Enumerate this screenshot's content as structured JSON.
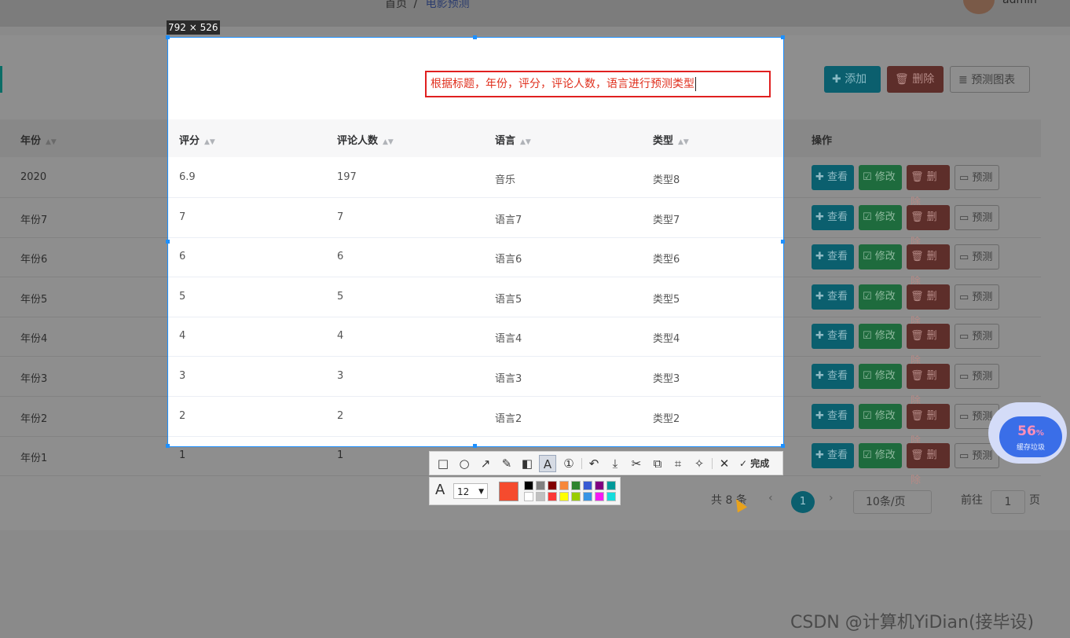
{
  "app": {
    "breadcrumb_home": "首页",
    "breadcrumb_sep": "/",
    "breadcrumb_current": "电影预测",
    "user": "admin"
  },
  "toolbar_buttons": {
    "add": "添加",
    "delete": "删除",
    "chart": "预测图表"
  },
  "table": {
    "headers": {
      "year": "年份",
      "score": "评分",
      "reviewers": "评论人数",
      "language": "语言",
      "type": "类型",
      "actions": "操作"
    },
    "rows": [
      {
        "year": "2020",
        "score": "6.9",
        "reviewers": "197",
        "language": "音乐",
        "type": "类型8"
      },
      {
        "year": "年份7",
        "score": "7",
        "reviewers": "7",
        "language": "语言7",
        "type": "类型7"
      },
      {
        "year": "年份6",
        "score": "6",
        "reviewers": "6",
        "language": "语言6",
        "type": "类型6"
      },
      {
        "year": "年份5",
        "score": "5",
        "reviewers": "5",
        "language": "语言5",
        "type": "类型5"
      },
      {
        "year": "年份4",
        "score": "4",
        "reviewers": "4",
        "language": "语言4",
        "type": "类型4"
      },
      {
        "year": "年份3",
        "score": "3",
        "reviewers": "3",
        "language": "语言3",
        "type": "类型3"
      },
      {
        "year": "年份2",
        "score": "2",
        "reviewers": "2",
        "language": "语言2",
        "type": "类型2"
      },
      {
        "year": "年份1",
        "score": "1",
        "reviewers": "1",
        "language": "",
        "type": ""
      }
    ],
    "row_actions": {
      "view": "查看",
      "edit": "修改",
      "delete": "删除",
      "predict": "预测"
    }
  },
  "pagination": {
    "total": "共 8 条",
    "current_page": "1",
    "page_size": "10条/页",
    "goto_label": "前往",
    "goto_value": "1",
    "page_suffix": "页"
  },
  "capture": {
    "size_label": "792 × 526",
    "annotation_text": "根据标题，年份，评分，评论人数，语言进行预测类型",
    "done_label": "完成",
    "font_size": "12",
    "current_color": "#f54b2e",
    "palette": [
      "#000000",
      "#808080",
      "#800000",
      "#f7883a",
      "#308430",
      "#385ad3",
      "#800080",
      "#009999",
      "#ffffff",
      "#c0c0c0",
      "#fb3838",
      "#ffff00",
      "#99cc00",
      "#3894e4",
      "#f31bf3",
      "#16dcdc"
    ]
  },
  "widget": {
    "percent": "56",
    "percent_sign": "%",
    "label": "缓存垃圾"
  },
  "watermark": "CSDN @计算机YiDian(接毕设)"
}
